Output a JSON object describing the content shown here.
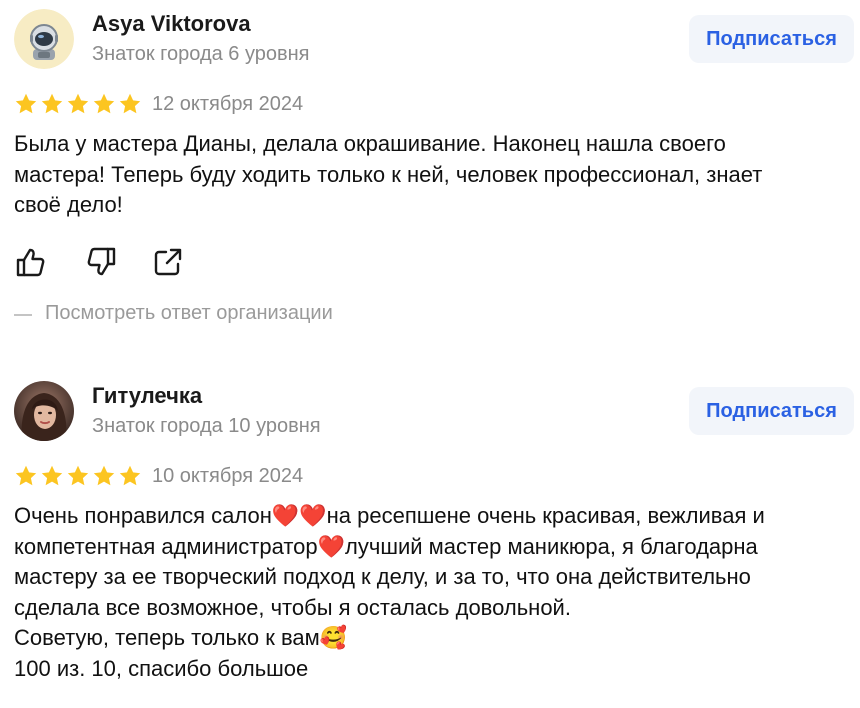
{
  "reviews": [
    {
      "author": "Asya Viktorova",
      "level": "Знаток города 6 уровня",
      "subscribe_label": "Подписаться",
      "rating": 5,
      "date": "12 октября 2024",
      "text": "Была у мастера Дианы, делала окрашивание. Наконец нашла своего\nмастера! Теперь буду ходить только к ней, человек профессионал, знает\nсвоё дело!",
      "org_reply_label": "Посмотреть ответ организации"
    },
    {
      "author": "Гитулечка",
      "level": "Знаток города 10 уровня",
      "subscribe_label": "Подписаться",
      "rating": 5,
      "date": "10 октября 2024",
      "text": "Очень понравился салон❤️❤️на ресепшене очень красивая, вежливая и\nкомпетентная администратор❤️лучший мастер маникюра, я благодарна\nмастеру за ее творческий подход к делу, и за то, что она действительно\nсделала все возможное, чтобы я осталась довольной.\nСоветую, теперь только к вам🥰\n100 из. 10, спасибо большое"
    }
  ],
  "colors": {
    "star": "#fcc521",
    "accent": "#2b61e3",
    "button_bg": "#f2f5fa",
    "muted_text": "#8a8a8a"
  },
  "icons": {
    "like": "thumbs-up-icon",
    "dislike": "thumbs-down-icon",
    "share": "share-icon",
    "avatar_1": "astronaut-avatar",
    "avatar_2": "photo-avatar"
  }
}
